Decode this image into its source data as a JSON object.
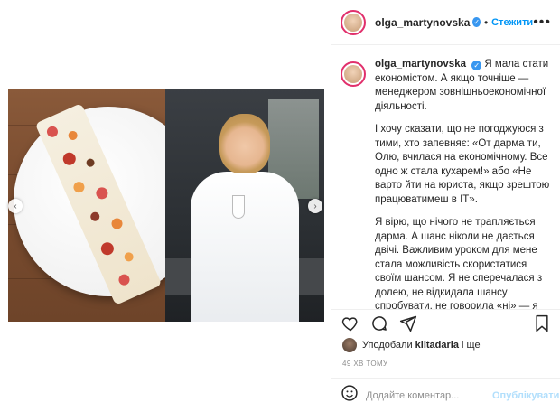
{
  "post": {
    "username": "olga_martynovska",
    "follow_label": "Стежити",
    "more_label": "•••",
    "separator": "•",
    "verified_icon": "✓"
  },
  "caption": {
    "username": "olga_martynovska",
    "lines": [
      "Я мала стати економістом. А якщо точніше — менеджером зовнішньоекономічної діяльності.",
      "І хочу сказати, що не погоджуюся з тими, хто запевняє: «От дарма ти, Олю, вчилася на економічному. Все одно ж стала кухарем!» або «Не варто йти на юриста, якщо зрештою працюватимеш в IT».",
      "Я вірю, що нічого не трапляється дарма. А шанс ніколи не дається двічі. Важливим уроком для мене стала можливість скористатися своїм шансом. Я не сперечалася з долею, не відкидала шансу спробувати, не говорила «ні» — я"
    ]
  },
  "likes": {
    "prefix": "Уподобали",
    "user": "kiltadarla",
    "suffix": "і ще"
  },
  "time_ago": "49 ХВ ТОМУ",
  "comment": {
    "placeholder": "Додайте коментар...",
    "publish_label": "Опублікувати"
  },
  "carousel": {
    "prev_icon": "‹",
    "next_icon": "›"
  },
  "icons": {
    "like": "heart-icon",
    "comment": "comment-icon",
    "share": "share-icon",
    "save": "bookmark-icon",
    "emoji": "emoji-icon"
  },
  "colors": {
    "accent": "#0095f6",
    "verified": "#3897f0",
    "publish_disabled": "#b2dffc",
    "muted": "#8e8e8e"
  }
}
